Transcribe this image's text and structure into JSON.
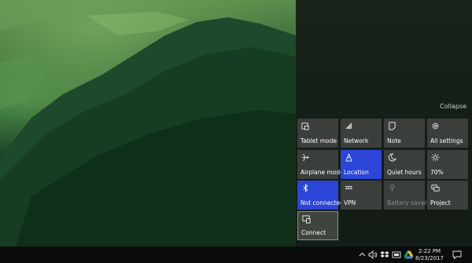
{
  "action_center": {
    "collapse_label": "Collapse",
    "tiles": [
      {
        "label": "Tablet mode",
        "icon": "tablet-mode-icon",
        "state": "off"
      },
      {
        "label": "Network",
        "icon": "network-icon",
        "state": "off"
      },
      {
        "label": "Note",
        "icon": "note-icon",
        "state": "off"
      },
      {
        "label": "All settings",
        "icon": "gear-icon",
        "state": "off"
      },
      {
        "label": "Airplane mode",
        "icon": "airplane-icon",
        "state": "off"
      },
      {
        "label": "Location",
        "icon": "location-icon",
        "state": "on"
      },
      {
        "label": "Quiet hours",
        "icon": "moon-icon",
        "state": "off"
      },
      {
        "label": "70%",
        "icon": "brightness-icon",
        "state": "off"
      },
      {
        "label": "Not connected",
        "icon": "bluetooth-icon",
        "state": "on"
      },
      {
        "label": "VPN",
        "icon": "vpn-icon",
        "state": "off"
      },
      {
        "label": "Battery saver",
        "icon": "battery-saver-icon",
        "state": "disabled"
      },
      {
        "label": "Project",
        "icon": "project-icon",
        "state": "off"
      },
      {
        "label": "Connect",
        "icon": "connect-icon",
        "state": "focused"
      }
    ],
    "accent_color": "#2b45d8"
  },
  "taskbar": {
    "time": "2:22 PM",
    "date": "8/23/2017",
    "tray_icons": [
      "chevron-up-icon",
      "volume-icon",
      "dropbox-icon",
      "network-status-icon",
      "google-drive-icon",
      "notification-icon"
    ]
  }
}
